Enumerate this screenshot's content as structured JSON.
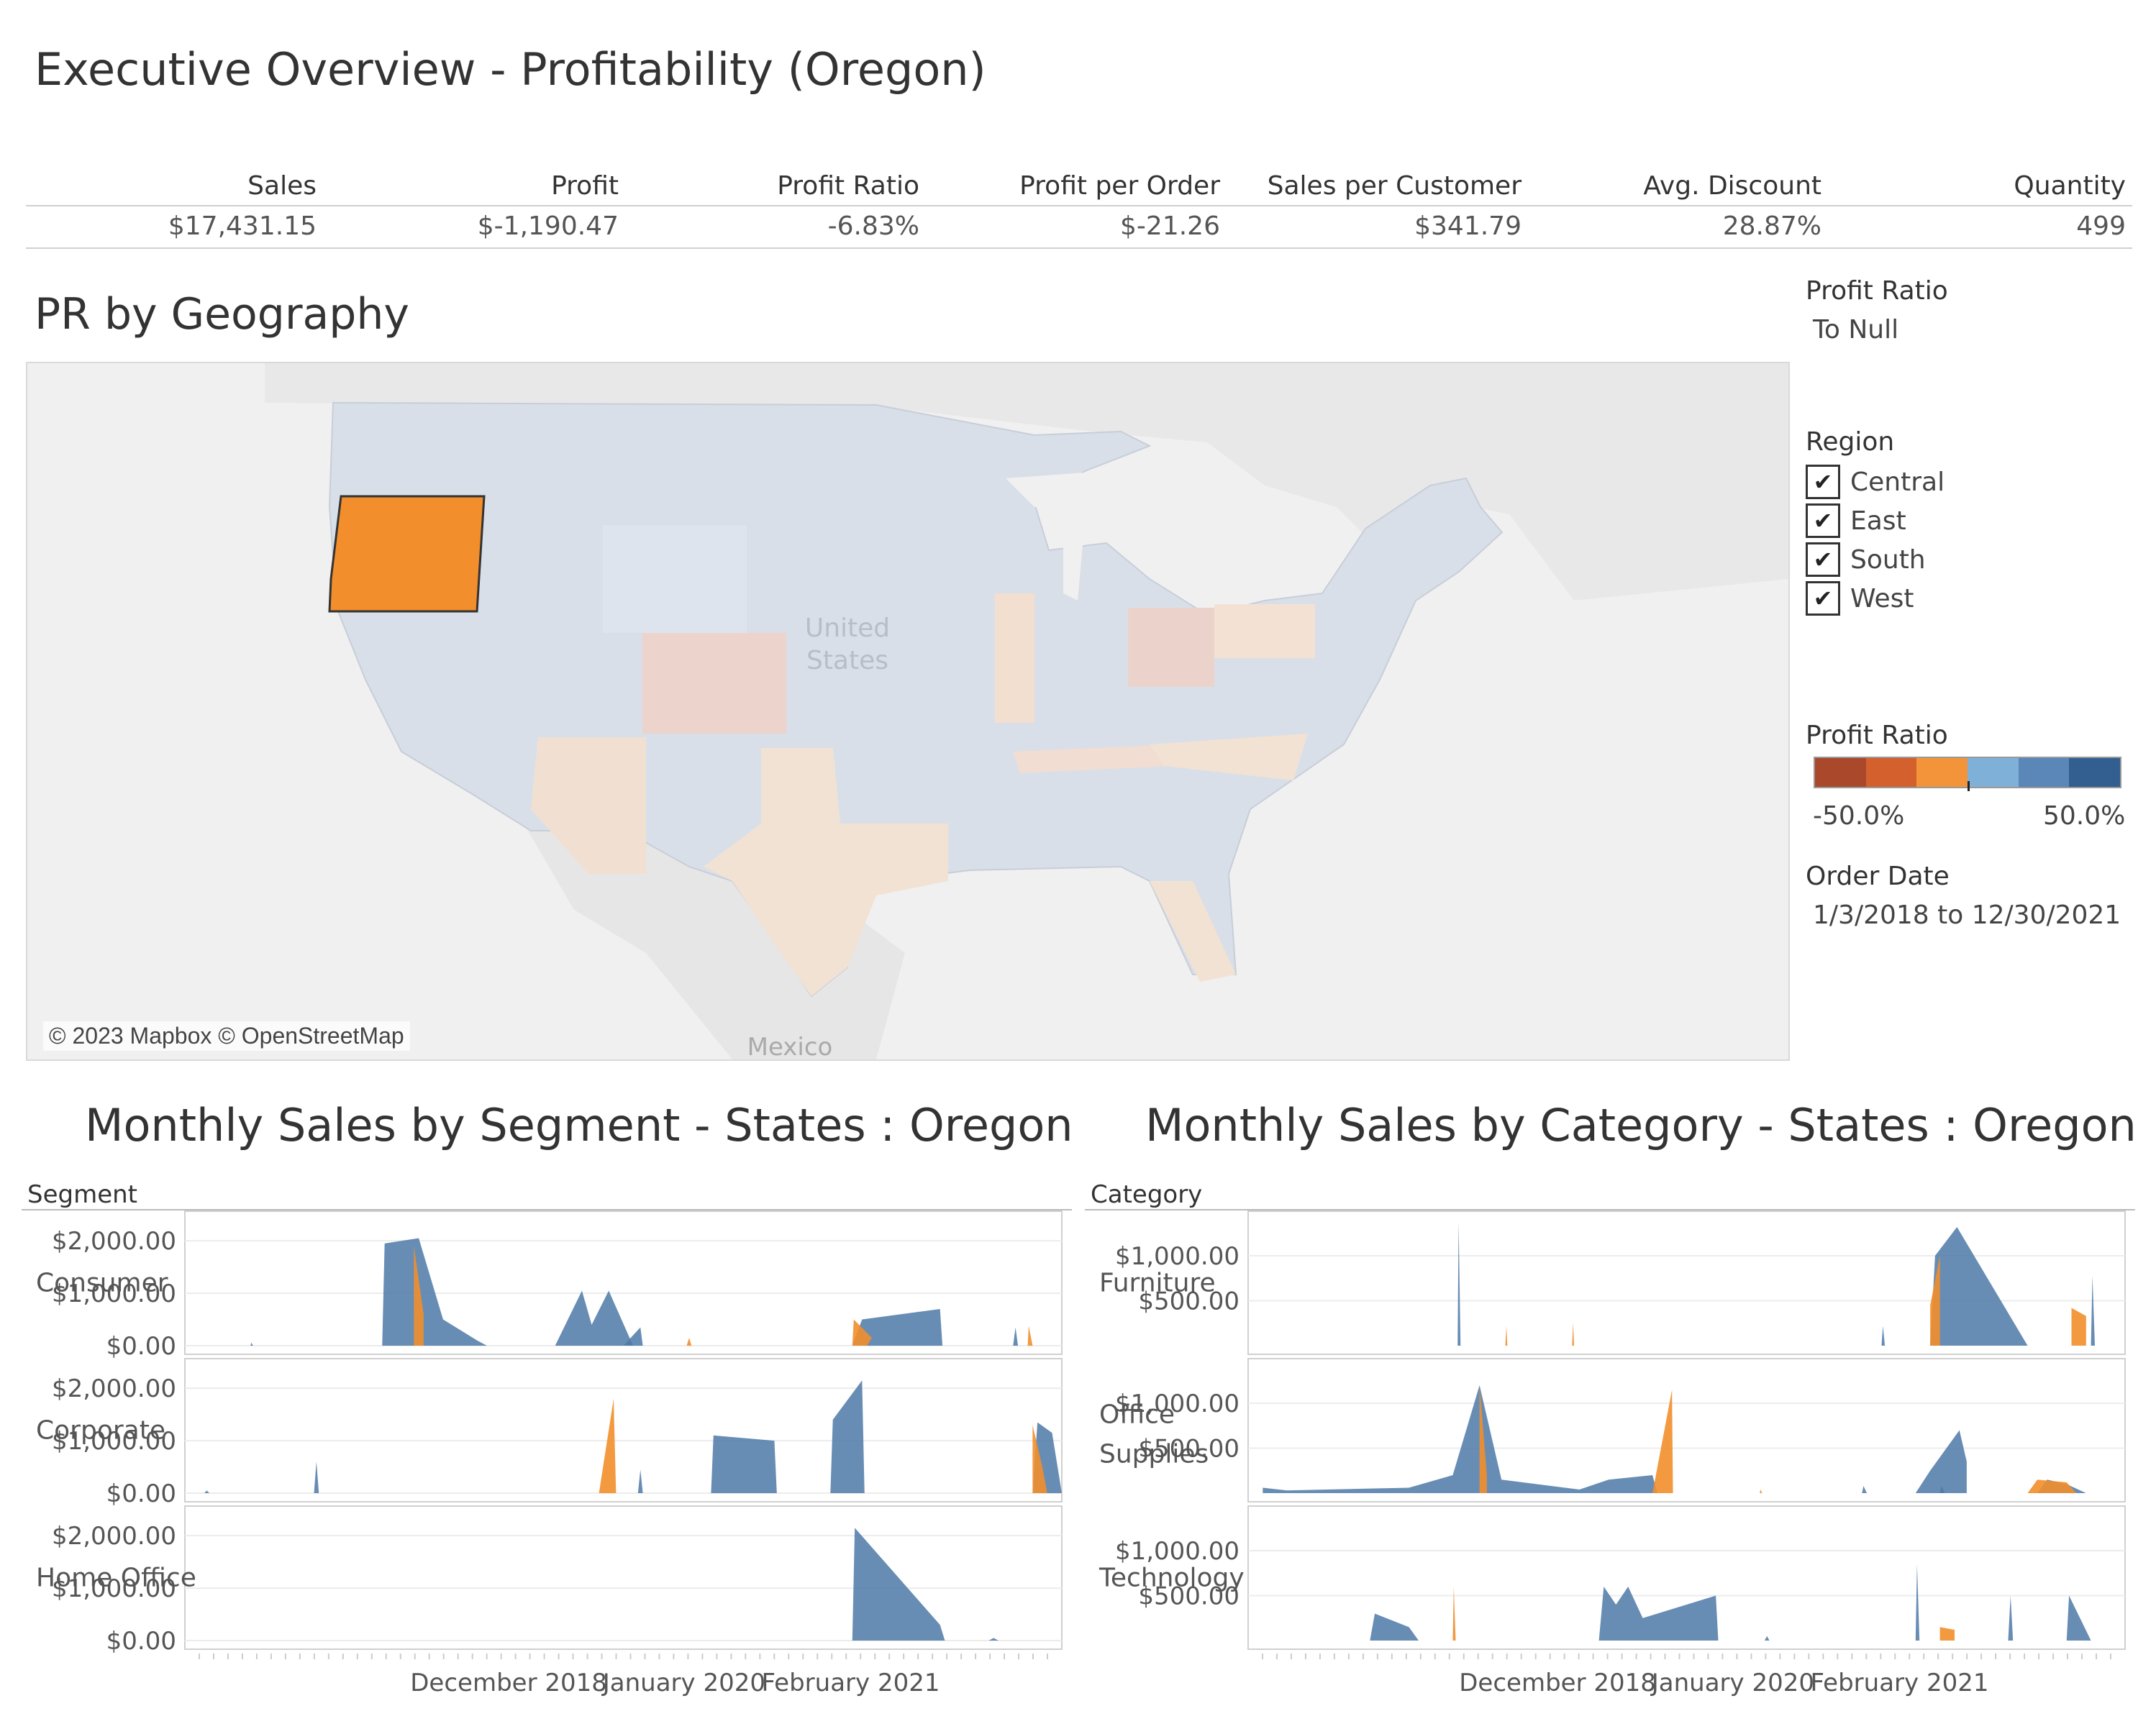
{
  "page": {
    "title": "Executive Overview - Profitability (Oregon)"
  },
  "kpis": [
    {
      "label": "Sales",
      "value": "$17,431.15"
    },
    {
      "label": "Profit",
      "value": "$-1,190.47"
    },
    {
      "label": "Profit Ratio",
      "value": "-6.83%"
    },
    {
      "label": "Profit per Order",
      "value": "$-21.26"
    },
    {
      "label": "Sales per Customer",
      "value": "$341.79"
    },
    {
      "label": "Avg. Discount",
      "value": "28.87%"
    },
    {
      "label": "Quantity",
      "value": "499"
    }
  ],
  "map": {
    "title": "PR by Geography",
    "label_country": [
      "United",
      "States"
    ],
    "label_mexico": "Mexico",
    "credit": "© 2023 Mapbox © OpenStreetMap",
    "highlighted_state": "Oregon"
  },
  "filters": {
    "profit_ratio": {
      "title": "Profit Ratio",
      "value": "To Null"
    },
    "region": {
      "title": "Region",
      "items": [
        {
          "label": "Central",
          "checked": true
        },
        {
          "label": "East",
          "checked": true
        },
        {
          "label": "South",
          "checked": true
        },
        {
          "label": "West",
          "checked": true
        }
      ]
    },
    "color_legend": {
      "title": "Profit Ratio",
      "min_label": "-50.0%",
      "max_label": "50.0%",
      "colors": [
        "#a9482a",
        "#d4612d",
        "#f4943a",
        "#7fb1d8",
        "#5a87b8",
        "#325f8f"
      ]
    },
    "order_date": {
      "title": "Order Date",
      "value": "1/3/2018 to 12/30/2021"
    }
  },
  "colors": {
    "positive": "#4e79a7",
    "negative": "#f28e2b",
    "oregon": "#f28e2b"
  },
  "chart_data": [
    {
      "type": "area",
      "title": "Monthly Sales by Segment - States : Oregon",
      "facet_label": "Segment",
      "x_ticks": [
        "December 2018",
        "January 2020",
        "February 2021"
      ],
      "ylim": [
        0,
        2400
      ],
      "y_ticks": [
        "$0.00",
        "$1,000.00",
        "$2,000.00"
      ],
      "panels": [
        {
          "name": "Consumer",
          "points": [
            [
              0.12,
              0,
              0.05
            ],
            [
              0.38,
              0,
              1950
            ],
            [
              0.44,
              0,
              2000
            ],
            [
              0.465,
              0,
              1750
            ],
            [
              0.5,
              0,
              700
            ],
            [
              0.58,
              0,
              200
            ],
            [
              0.63,
              0,
              0
            ],
            [
              0.77,
              0,
              1050
            ],
            [
              0.79,
              0,
              400
            ],
            [
              0.82,
              0,
              1050
            ],
            [
              0.85,
              0,
              300
            ],
            [
              0.87,
              0,
              0
            ]
          ],
          "neg": [
            [
              0.455,
              1750
            ],
            [
              0.47,
              0
            ]
          ],
          "extra_blue": [
            [
              1.25,
              0,
              400
            ],
            [
              1.37,
              0,
              400
            ],
            [
              1.39,
              0,
              0
            ]
          ],
          "extra_orange": [
            [
              1.22,
              0,
              350
            ],
            [
              1.24,
              0,
              0
            ]
          ]
        }
      ]
    },
    {
      "type": "area",
      "title": "Monthly Sales by Category - States : Oregon",
      "facet_label": "Category",
      "x_ticks": [
        "December 2018",
        "January 2020",
        "February 2021"
      ],
      "ylim": [
        0,
        1400
      ],
      "y_ticks": [
        "$500.00",
        "$1,000.00"
      ],
      "panels": [
        {
          "name": "Furniture"
        },
        {
          "name": "Office Supplies"
        },
        {
          "name": "Technology"
        }
      ]
    }
  ]
}
